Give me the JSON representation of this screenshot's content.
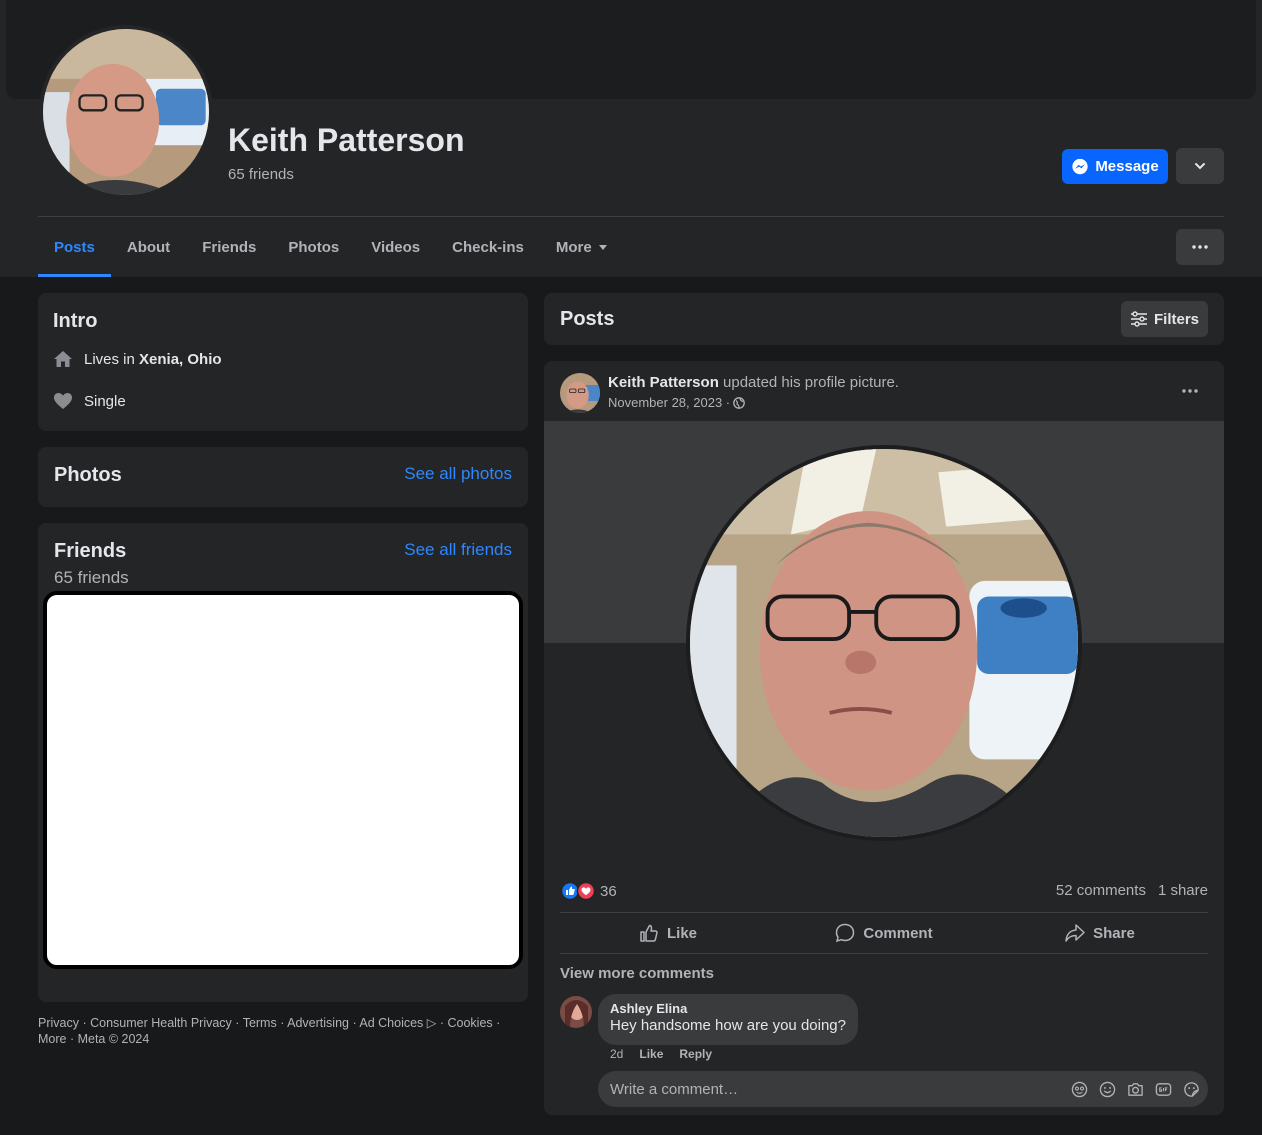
{
  "profile": {
    "name": "Keith Patterson",
    "friends_count": "65 friends",
    "message_label": "Message"
  },
  "tabs": [
    {
      "label": "Posts",
      "active": true
    },
    {
      "label": "About"
    },
    {
      "label": "Friends"
    },
    {
      "label": "Photos"
    },
    {
      "label": "Videos"
    },
    {
      "label": "Check-ins"
    },
    {
      "label": "More"
    }
  ],
  "intro": {
    "title": "Intro",
    "lives_prefix": "Lives in ",
    "lives_place": "Xenia, Ohio",
    "relationship": "Single"
  },
  "photos": {
    "title": "Photos",
    "see_all": "See all photos"
  },
  "friends": {
    "title": "Friends",
    "see_all": "See all friends",
    "count": "65 friends"
  },
  "footer": {
    "line1": "Privacy · Consumer Health Privacy · Terms · Advertising · Ad Choices ▷ · Cookies ·",
    "line2": "More · Meta © 2024"
  },
  "posts": {
    "title": "Posts",
    "filters_label": "Filters"
  },
  "post": {
    "author": "Keith Patterson",
    "action": " updated his profile picture.",
    "date": "November 28, 2023 ·",
    "reaction_count": "36",
    "comments": "52 comments",
    "shares": "1 share",
    "like_label": "Like",
    "comment_label": "Comment",
    "share_label": "Share",
    "view_more": "View more comments",
    "comment": {
      "name": "Ashley Elina",
      "text": "Hey handsome how are you doing?",
      "time": "2d",
      "like": "Like",
      "reply": "Reply"
    },
    "comment_placeholder": "Write a comment…"
  },
  "colors": {
    "accent": "#2d88ff",
    "button_primary": "#0866ff",
    "page_bg": "#18191a",
    "card_bg": "#242526"
  },
  "icons": {
    "message": "messenger-icon",
    "dropdown": "chevron-down-icon",
    "home": "home-icon",
    "heart": "heart-icon",
    "filters": "sliders-icon",
    "globe": "globe-icon",
    "like": "thumbs-up-icon",
    "comment": "speech-bubble-icon",
    "share": "share-arrow-icon"
  }
}
